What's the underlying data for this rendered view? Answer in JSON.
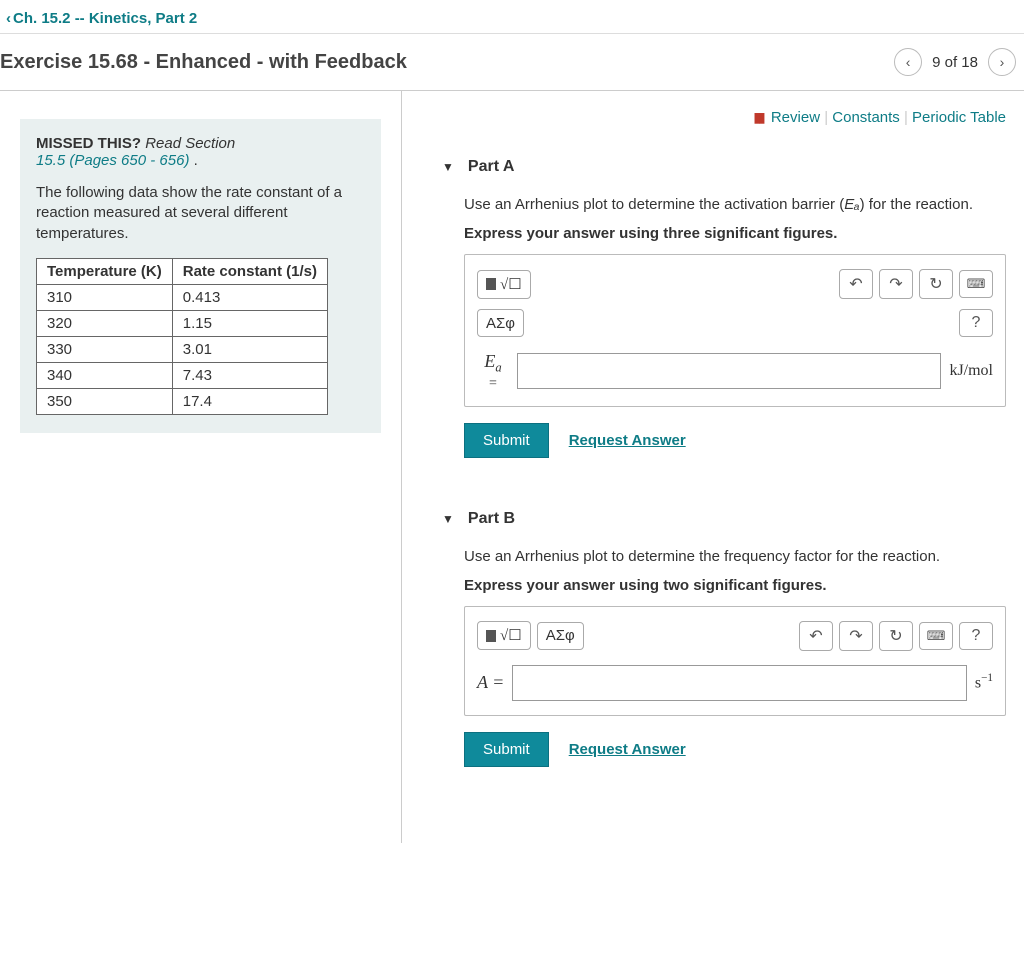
{
  "breadcrumb": "Ch. 15.2 -- Kinetics, Part 2",
  "exercise_title": "Exercise 15.68 - Enhanced - with Feedback",
  "pager": {
    "position": "9 of 18"
  },
  "hint": {
    "missed_label": "MISSED THIS?",
    "read_section": "Read Section",
    "section_ref": "15.5 (Pages 650 - 656)",
    "period": " .",
    "intro": "The following data show the rate constant of a reaction measured at several different temperatures."
  },
  "table": {
    "headers": {
      "temp": "Temperature (K)",
      "rate": "Rate constant (1/s)"
    },
    "rows": [
      {
        "temp": "310",
        "rate": "0.413"
      },
      {
        "temp": "320",
        "rate": "1.15"
      },
      {
        "temp": "330",
        "rate": "3.01"
      },
      {
        "temp": "340",
        "rate": "7.43"
      },
      {
        "temp": "350",
        "rate": "17.4"
      }
    ]
  },
  "toplinks": {
    "review": "Review",
    "constants": "Constants",
    "periodic": "Periodic Table"
  },
  "partA": {
    "title": "Part A",
    "prompt_pre": "Use an Arrhenius plot to determine the activation barrier (",
    "prompt_var": "Eₐ",
    "prompt_post": ") for the reaction.",
    "sigfig": "Express your answer using three significant figures.",
    "var_label": "Eₐ",
    "units": "kJ/mol",
    "submit": "Submit",
    "request": "Request Answer",
    "greek_btn": "ΑΣφ",
    "help_btn": "?"
  },
  "partB": {
    "title": "Part B",
    "prompt": "Use an Arrhenius plot to determine the frequency factor for the reaction.",
    "sigfig": "Express your answer using two significant figures.",
    "var_label": "A =",
    "units_base": "s",
    "units_exp": "−1",
    "submit": "Submit",
    "request": "Request Answer",
    "greek_btn": "ΑΣφ",
    "help_btn": "?"
  }
}
